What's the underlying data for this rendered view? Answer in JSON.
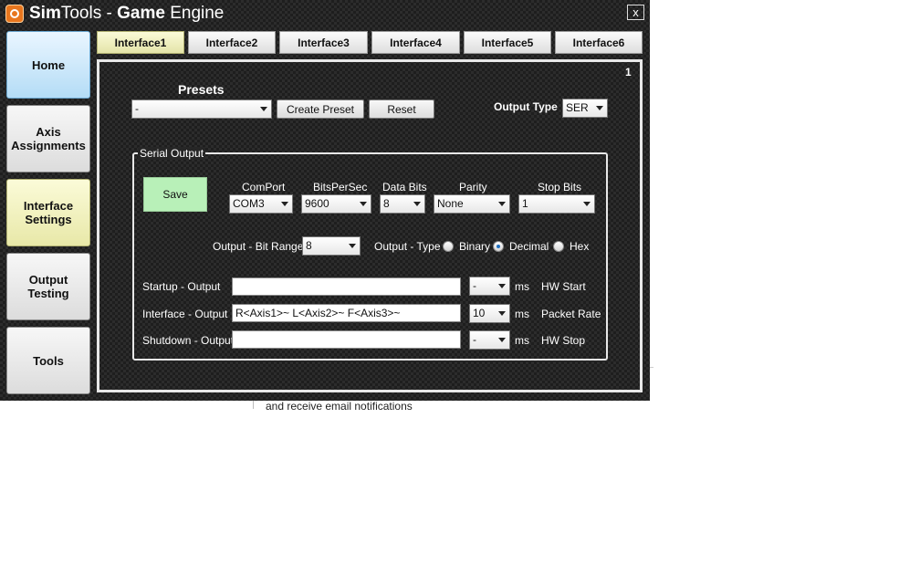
{
  "window": {
    "title_sim": "Sim",
    "title_tools": "Tools - ",
    "title_game": "Game",
    "title_engine": " Engine",
    "close_label": "x"
  },
  "nav": [
    {
      "label_line1": "Home",
      "label_line2": ""
    },
    {
      "label_line1": "Axis",
      "label_line2": "Assignments"
    },
    {
      "label_line1": "Interface",
      "label_line2": "Settings"
    },
    {
      "label_line1": "Output",
      "label_line2": "Testing"
    },
    {
      "label_line1": "Tools",
      "label_line2": ""
    }
  ],
  "tabs": [
    "Interface1",
    "Interface2",
    "Interface3",
    "Interface4",
    "Interface5",
    "Interface6"
  ],
  "active_tab": "Interface1",
  "panel": {
    "page_number": "1",
    "presets_label": "Presets",
    "presets_value": "-",
    "create_preset_label": "Create Preset",
    "reset_label": "Reset",
    "output_type_label": "Output Type",
    "output_type_value": "SER"
  },
  "serial": {
    "group_title": "Serial Output",
    "save_label": "Save",
    "comport_label": "ComPort",
    "comport_value": "COM3",
    "bitspersec_label": "BitsPerSec",
    "bitspersec_value": "9600",
    "databits_label": "Data Bits",
    "databits_value": "8",
    "parity_label": "Parity",
    "parity_value": "None",
    "stopbits_label": "Stop Bits",
    "stopbits_value": "1",
    "bitrange_label": "Output - Bit Range",
    "bitrange_value": "8",
    "outtype_label": "Output - Type",
    "radio_binary": "Binary",
    "radio_decimal": "Decimal",
    "radio_hex": "Hex",
    "selected_type": "Decimal",
    "startup_label": "Startup - Output",
    "startup_value": "",
    "startup_ms_value": "-",
    "startup_ms_unit": "ms",
    "startup_desc": "HW Start",
    "interface_label": "Interface - Output",
    "interface_value": "R<Axis1>~ L<Axis2>~ F<Axis3>~",
    "interface_ms_value": "10",
    "interface_ms_unit": "ms",
    "interface_desc": "Packet Rate",
    "shutdown_label": "Shutdown - Output",
    "shutdown_value": "",
    "shutdown_ms_value": "-",
    "shutdown_ms_unit": "ms",
    "shutdown_desc": "HW Stop"
  },
  "background": {
    "text": "and receive email notifications"
  }
}
